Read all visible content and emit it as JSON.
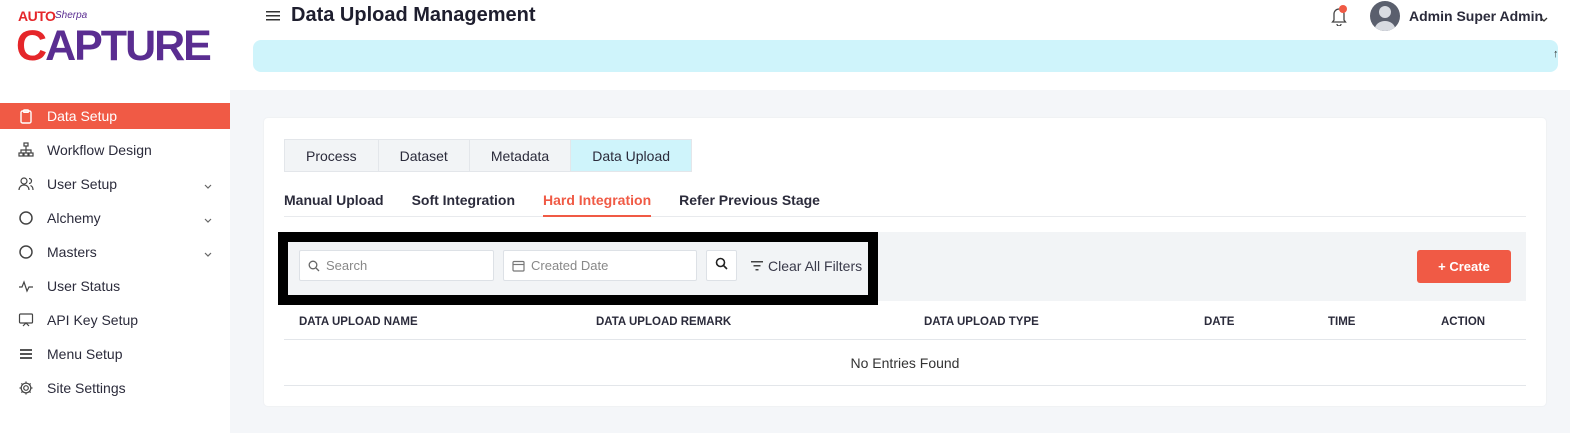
{
  "brand": {
    "auto": "AUTO",
    "sherpa": "Sherpa",
    "capture_a": "C",
    "capture_b": "APTURE"
  },
  "sidebar": {
    "items": [
      {
        "label": "Data Setup",
        "icon": "clipboard-icon",
        "active": true,
        "expandable": false
      },
      {
        "label": "Workflow Design",
        "icon": "hierarchy-icon",
        "active": false,
        "expandable": false
      },
      {
        "label": "User Setup",
        "icon": "users-icon",
        "active": false,
        "expandable": true
      },
      {
        "label": "Alchemy",
        "icon": "circle-icon",
        "active": false,
        "expandable": true
      },
      {
        "label": "Masters",
        "icon": "circle-icon",
        "active": false,
        "expandable": true
      },
      {
        "label": "User Status",
        "icon": "activity-icon",
        "active": false,
        "expandable": false
      },
      {
        "label": "API Key Setup",
        "icon": "screen-icon",
        "active": false,
        "expandable": false
      },
      {
        "label": "Menu Setup",
        "icon": "list-icon",
        "active": false,
        "expandable": false
      },
      {
        "label": "Site Settings",
        "icon": "gear-icon",
        "active": false,
        "expandable": false
      }
    ]
  },
  "header": {
    "title": "Data Upload Management",
    "user_name": "Admin Super Admin",
    "banner_mark": "↑"
  },
  "tabs": [
    "Process",
    "Dataset",
    "Metadata",
    "Data Upload"
  ],
  "active_tab": "Data Upload",
  "subtabs": [
    "Manual Upload",
    "Soft Integration",
    "Hard Integration",
    "Refer Previous Stage"
  ],
  "active_subtab": "Hard Integration",
  "filters": {
    "search_placeholder": "Search",
    "date_placeholder": "Created Date",
    "clear_label": "Clear All Filters",
    "create_label": "+ Create"
  },
  "table": {
    "columns": [
      "DATA UPLOAD NAME",
      "DATA UPLOAD REMARK",
      "DATA UPLOAD TYPE",
      "DATE",
      "TIME",
      "ACTION"
    ],
    "empty_text": "No Entries Found"
  },
  "colors": {
    "accent": "#f05a45",
    "info": "#cff4fb",
    "brand_purple": "#5a2d91",
    "brand_red": "#e5262a"
  }
}
